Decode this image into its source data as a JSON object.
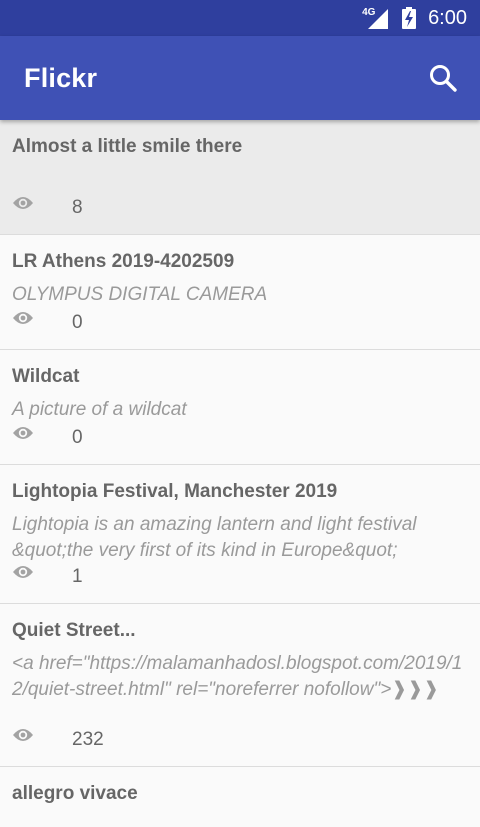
{
  "status": {
    "network": "4G",
    "time": "6:00"
  },
  "app": {
    "title": "Flickr"
  },
  "photos": [
    {
      "title": "Almost a little smile there",
      "description": "",
      "views": "8"
    },
    {
      "title": "LR Athens 2019-4202509",
      "description": "OLYMPUS DIGITAL CAMERA",
      "views": "0"
    },
    {
      "title": "Wildcat",
      "description": "A picture of a wildcat",
      "views": "0"
    },
    {
      "title": "Lightopia Festival, Manchester 2019",
      "description": "Lightopia is an amazing lantern and light festival &quot;the very first of its kind in Europe&quot;",
      "views": "1"
    },
    {
      "title": "Quiet Street...",
      "description": "<a href=\"https://malamanhadosl.blogspot.com/2019/12/quiet-street.html\" rel=\"noreferrer nofollow\">❱❱❱",
      "views": "232"
    },
    {
      "title": "allegro vivace",
      "description": "",
      "views": ""
    }
  ]
}
